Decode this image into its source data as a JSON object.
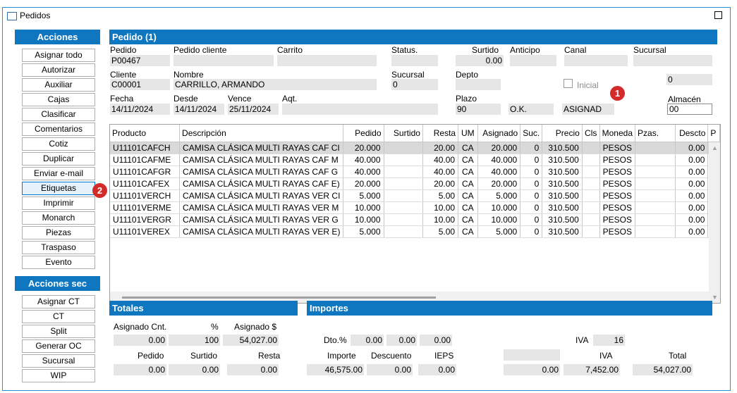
{
  "window": {
    "title": "Pedidos"
  },
  "acciones": {
    "title": "Acciones",
    "buttons": [
      "Asignar todo",
      "Autorizar",
      "Auxiliar",
      "Cajas",
      "Clasificar",
      "Comentarios",
      "Cotiz",
      "Duplicar",
      "Enviar e-mail",
      "Etiquetas",
      "Imprimir",
      "Monarch",
      "Piezas",
      "Traspaso",
      "Evento"
    ]
  },
  "acciones_sec": {
    "title": "Acciones sec",
    "buttons": [
      "Asignar CT",
      "CT",
      "Split",
      "Generar OC",
      "Sucursal",
      "WIP"
    ]
  },
  "header": {
    "title": "Pedido (1)",
    "pedido_label": "Pedido",
    "pedido_value": "P00467",
    "pedido_cliente_label": "Pedido cliente",
    "pedido_cliente_value": "",
    "carrito_label": "Carrito",
    "carrito_value": "",
    "status_label": "Status.",
    "status_value": "",
    "surtido_label": "Surtido",
    "surtido_value": "0.00",
    "anticipo_label": "Anticipo",
    "anticipo_value": "",
    "canal_label": "Canal",
    "canal_value": "",
    "sucursal_label": "Sucursal",
    "sucursal_value": "",
    "cliente_label": "Cliente",
    "cliente_value": "C00001",
    "nombre_label": "Nombre",
    "nombre_value": "CARRILLO, ARMANDO",
    "sucursal2_label": "Sucursal",
    "sucursal2_value": "0",
    "depto_label": "Depto",
    "depto_value": "",
    "inicial_label": "Inicial",
    "right_value": "0",
    "fecha_label": "Fecha",
    "fecha_value": "14/11/2024",
    "desde_label": "Desde",
    "desde_value": "14/11/2024",
    "vence_label": "Vence",
    "vence_value": "25/11/2024",
    "aqt_label": "Aqt.",
    "aqt_value": "",
    "plazo_label": "Plazo",
    "plazo_value": "90",
    "ok_value": "O.K.",
    "asignad_value": "ASIGNAD",
    "almacen_label": "Almacén",
    "almacen_value": "00"
  },
  "badges": {
    "one": "1",
    "two": "2"
  },
  "grid": {
    "columns": [
      "Producto",
      "Descripción",
      "Pedido",
      "Surtido",
      "Resta",
      "UM",
      "Asignado",
      "Suc.",
      "Precio",
      "Cls",
      "Moneda",
      "Pzas.",
      "Descto",
      "P"
    ],
    "rows": [
      [
        "U11101CAFCH",
        "CAMISA CLÁSICA MULTI RAYAS CAF CI",
        "20.000",
        "",
        "20.00",
        "CA",
        "20.000",
        "0",
        "310.500",
        "",
        "PESOS",
        "",
        "0.00",
        ""
      ],
      [
        "U11101CAFME",
        "CAMISA CLÁSICA MULTI RAYAS CAF M",
        "40.000",
        "",
        "40.00",
        "CA",
        "40.000",
        "0",
        "310.500",
        "",
        "PESOS",
        "",
        "0.00",
        ""
      ],
      [
        "U11101CAFGR",
        "CAMISA CLÁSICA MULTI RAYAS CAF G",
        "40.000",
        "",
        "40.00",
        "CA",
        "40.000",
        "0",
        "310.500",
        "",
        "PESOS",
        "",
        "0.00",
        ""
      ],
      [
        "U11101CAFEX",
        "CAMISA CLÁSICA MULTI RAYAS CAF E)",
        "20.000",
        "",
        "20.00",
        "CA",
        "20.000",
        "0",
        "310.500",
        "",
        "PESOS",
        "",
        "0.00",
        ""
      ],
      [
        "U11101VERCH",
        "CAMISA CLÁSICA MULTI RAYAS VER CI",
        "5.000",
        "",
        "5.00",
        "CA",
        "5.000",
        "0",
        "310.500",
        "",
        "PESOS",
        "",
        "0.00",
        ""
      ],
      [
        "U11101VERME",
        "CAMISA CLÁSICA MULTI RAYAS VER M",
        "10.000",
        "",
        "10.00",
        "CA",
        "10.000",
        "0",
        "310.500",
        "",
        "PESOS",
        "",
        "0.00",
        ""
      ],
      [
        "U11101VERGR",
        "CAMISA CLÁSICA MULTI RAYAS VER G",
        "10.000",
        "",
        "10.00",
        "CA",
        "10.000",
        "0",
        "310.500",
        "",
        "PESOS",
        "",
        "0.00",
        ""
      ],
      [
        "U11101VEREX",
        "CAMISA CLÁSICA MULTI RAYAS VER E)",
        "5.000",
        "",
        "5.00",
        "CA",
        "5.000",
        "0",
        "310.500",
        "",
        "PESOS",
        "",
        "0.00",
        ""
      ]
    ]
  },
  "totales": {
    "title": "Totales",
    "asignado_cnt_label": "Asignado Cnt.",
    "pct_label": "%",
    "asignado_amt_label": "Asignado $",
    "asignado_cnt_value": "0.00",
    "pct_value": "100",
    "asignado_amt_value": "54,027.00",
    "pedido_label": "Pedido",
    "surtido_label": "Surtido",
    "resta_label": "Resta",
    "pedido_value": "0.00",
    "surtido_value": "0.00",
    "resta_value": "0.00"
  },
  "importes": {
    "title": "Importes",
    "dto_label": "Dto.%",
    "dto1": "0.00",
    "dto2": "0.00",
    "dto3": "0.00",
    "iva_label_top": "IVA",
    "iva_rate": "16",
    "importe_label": "Importe",
    "descuento_label": "Descuento",
    "ieps_label": "IEPS",
    "iva_label": "IVA",
    "total_label": "Total",
    "importe_value": "46,575.00",
    "descuento_value": "0.00",
    "ieps_value": "0.00",
    "blank_value": "",
    "extra_value": "0.00",
    "iva_value": "7,452.00",
    "total_value": "54,027.00"
  }
}
